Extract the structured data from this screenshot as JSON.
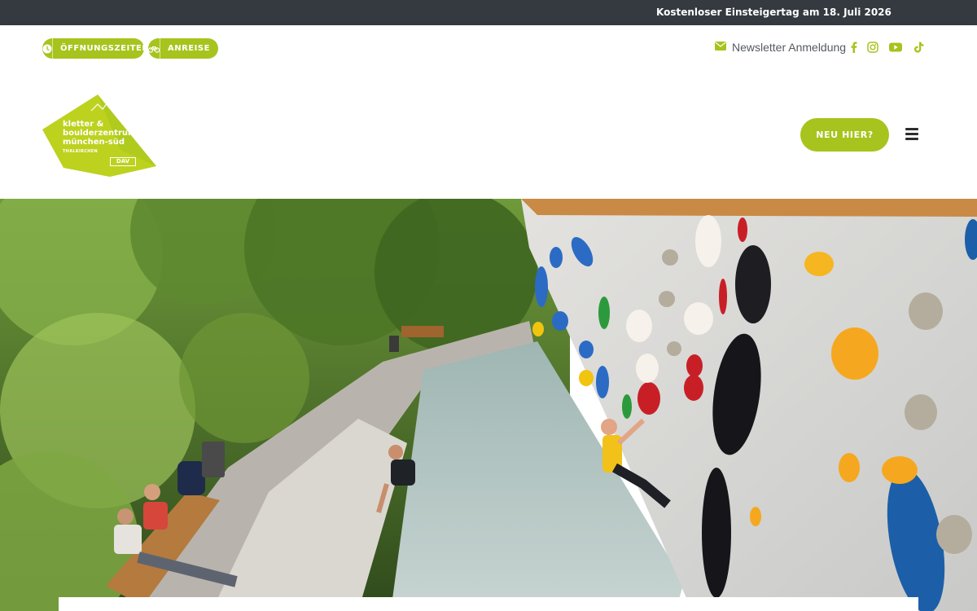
{
  "announcement": {
    "text": "Kostenloser Einsteigertag am 18. Juli 2026"
  },
  "utility": {
    "hours_label": "Öffnungszeiten",
    "travel_label": "Anreise",
    "newsletter_label": "Newsletter Anmeldung",
    "social": [
      "facebook-icon",
      "instagram-icon",
      "youtube-icon",
      "tiktok-icon"
    ]
  },
  "logo": {
    "line1": "kletter &",
    "line2": "boulderzentrum",
    "line3": "münchen-süd",
    "line4": "THALKIRCHEN",
    "badge": "DAV"
  },
  "header": {
    "cta_label": "Neu hier?"
  },
  "hero": {
    "image": "outdoor-bouldering-wall-photo"
  },
  "colors": {
    "accent": "#a6c41d",
    "topbar": "#343a40",
    "text": "#555a60"
  }
}
